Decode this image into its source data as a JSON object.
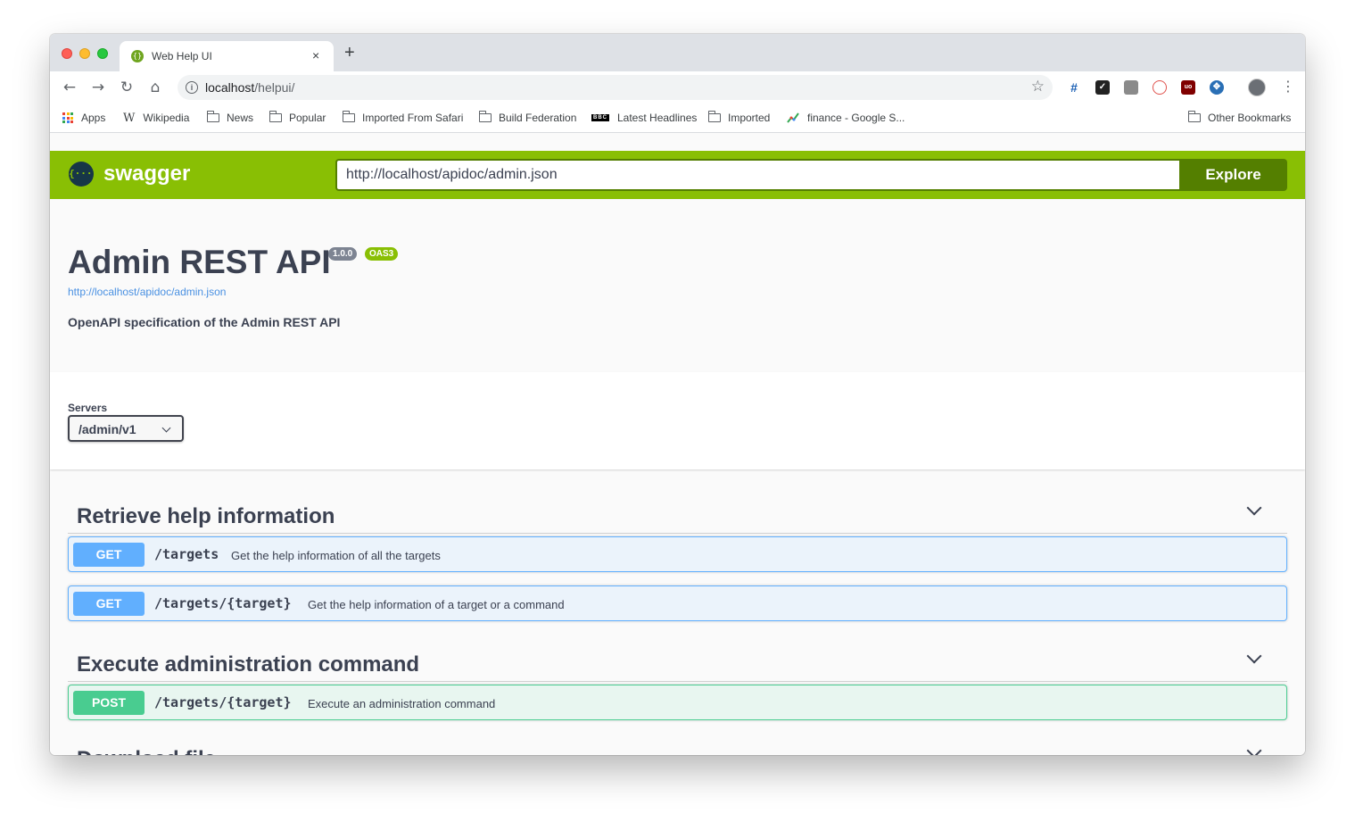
{
  "browser": {
    "tab_title": "Web Help UI",
    "tab_close": "×",
    "new_tab": "+",
    "url_host": "localhost",
    "url_path": "/helpui/",
    "bookmarks": [
      {
        "label": "Apps",
        "icon": "apps-grid-icon"
      },
      {
        "label": "Wikipedia",
        "icon": "wikipedia-icon"
      },
      {
        "label": "News",
        "icon": "folder-icon"
      },
      {
        "label": "Popular",
        "icon": "folder-icon"
      },
      {
        "label": "Imported From Safari",
        "icon": "folder-icon"
      },
      {
        "label": "Build Federation",
        "icon": "folder-icon"
      },
      {
        "label": "Latest Headlines",
        "icon": "bbc-icon"
      },
      {
        "label": "Imported",
        "icon": "folder-icon"
      },
      {
        "label": "finance - Google S...",
        "icon": "finance-icon"
      },
      {
        "label": "Other Bookmarks",
        "icon": "folder-icon"
      }
    ],
    "wiki_glyph": "W",
    "bbc_glyph": "BBC"
  },
  "swagger": {
    "brand": "swagger",
    "logo_glyph": "{···}",
    "spec_url": "http://localhost/apidoc/admin.json",
    "explore_label": "Explore"
  },
  "info": {
    "title": "Admin REST API",
    "version": "1.0.0",
    "oas_badge": "OAS3",
    "spec_link": "http://localhost/apidoc/admin.json",
    "description": "OpenAPI specification of the Admin REST API"
  },
  "servers": {
    "label": "Servers",
    "selected": "/admin/v1"
  },
  "tags": [
    {
      "name": "Retrieve help information",
      "operations": [
        {
          "method": "GET",
          "path": "/targets",
          "summary": "Get the help information of all the targets"
        },
        {
          "method": "GET",
          "path": "/targets/{target}",
          "summary": "Get the help information of a target or a command"
        }
      ]
    },
    {
      "name": "Execute administration command",
      "operations": [
        {
          "method": "POST",
          "path": "/targets/{target}",
          "summary": "Execute an administration command"
        }
      ]
    },
    {
      "name": "Download file",
      "operations": []
    }
  ]
}
